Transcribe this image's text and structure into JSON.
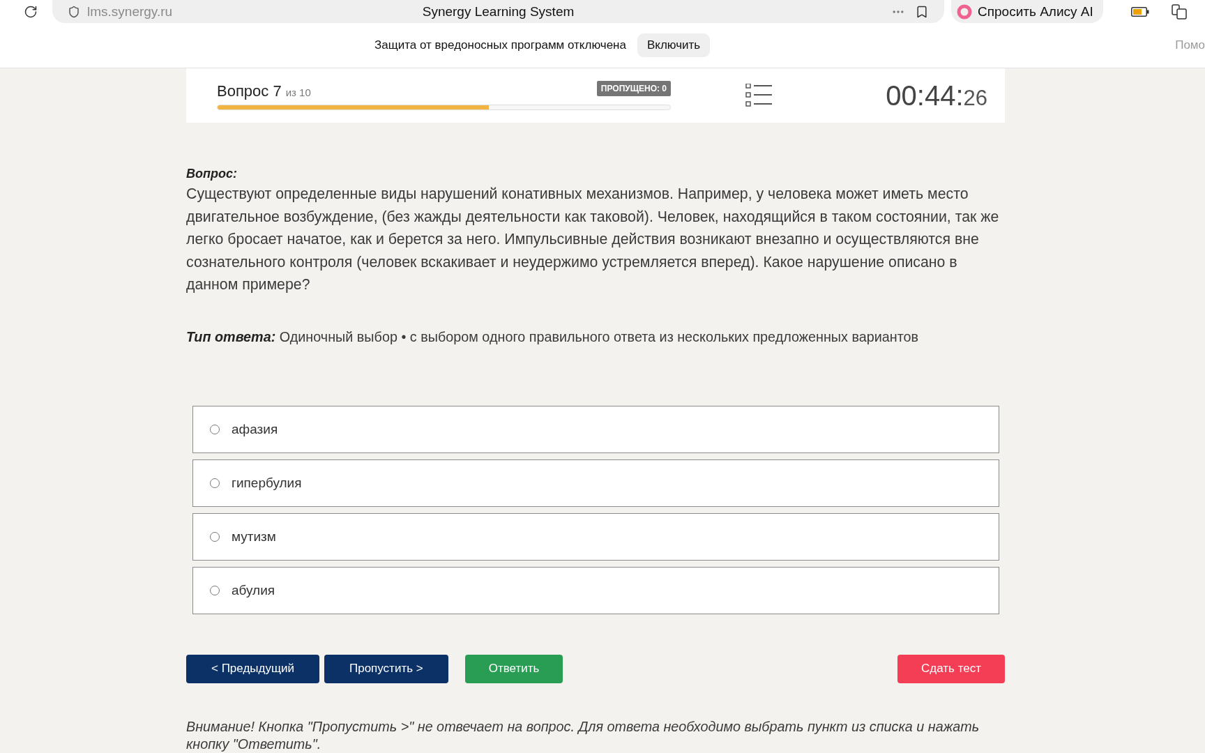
{
  "browser": {
    "address": "lms.synergy.ru",
    "page_title": "Synergy Learning System",
    "alice_button": "Спросить Алису AI",
    "notice": {
      "text": "Защита от вредоносных программ отключена",
      "button": "Включить"
    },
    "side_link": "Помо"
  },
  "header": {
    "question_label": "Вопрос 7",
    "question_total": "из 10",
    "skipped_badge": "ПРОПУЩЕНО: 0",
    "progress": {
      "level": 0.6
    },
    "timer": {
      "main": "00:44:",
      "seconds": "26"
    }
  },
  "question": {
    "heading": "Вопрос:",
    "text": "Существуют определенные виды нарушений конативных механизмов. Например, у человека может иметь место двигательное возбуждение, (без жажды деятельности как таковой). Человек, находящийся в таком состоянии, так же легко бросает начатое, как и берется за него. Импульсивные действия возникают внезапно и осуществляются вне сознательного контроля (человек вскакивает и неудержимо устремляется вперед). Какое нарушение описано в данном примере?",
    "answer_type": "**Тип ответа:** Одиночный выбор • с выбором одного правильного ответа из нескольких предложенных вариантов"
  },
  "options": [
    {
      "label": "афазия",
      "selected": false
    },
    {
      "label": "гипербулия",
      "selected": false
    },
    {
      "label": "мутизм",
      "selected": false
    },
    {
      "label": "абулия",
      "selected": false
    }
  ],
  "buttons": [
    {
      "label": "< Предыдущий",
      "kind": "nav"
    },
    {
      "label": "Пропустить >",
      "kind": "nav"
    },
    {
      "label": "Ответить",
      "kind": "submit"
    },
    {
      "label": "Сдать тест",
      "kind": "finish"
    }
  ],
  "warning": "Внимание! Кнопка \"Пропустить >\" не отвечает на вопрос. Для ответа необходимо выбрать пункт из списка и нажать кнопку \"Ответить\"."
}
